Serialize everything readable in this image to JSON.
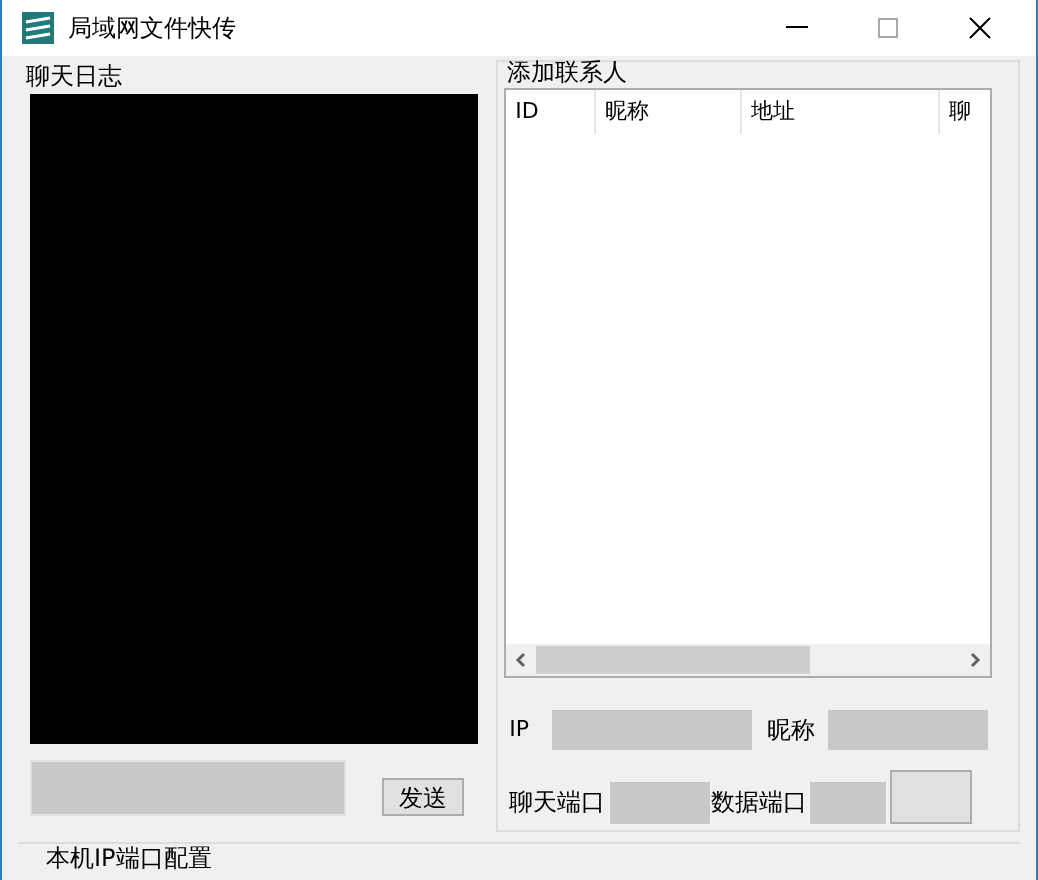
{
  "window": {
    "title": "局域网文件快传"
  },
  "chat_log": {
    "title": "聊天日志",
    "send_button": "发送"
  },
  "contacts": {
    "title": "添加联系人",
    "columns": [
      "ID",
      "昵称",
      "地址",
      "聊"
    ],
    "ip_label": "IP",
    "nickname_label": "昵称",
    "chat_port_label": "聊天端口",
    "data_port_label": "数据端口"
  },
  "local_config": {
    "title": "本机IP端口配置"
  }
}
